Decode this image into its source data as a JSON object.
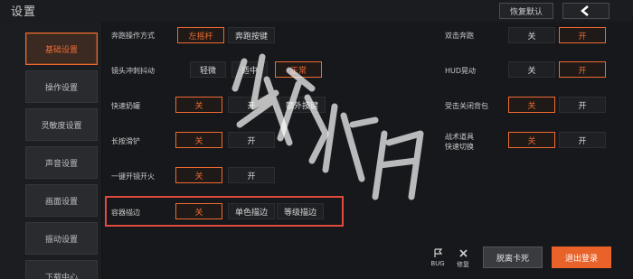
{
  "header": {
    "title": "设置",
    "reset_label": "恢复默认"
  },
  "sidebar": {
    "items": [
      {
        "label": "基础设置",
        "active": true
      },
      {
        "label": "操作设置",
        "active": false
      },
      {
        "label": "灵敏度设置",
        "active": false
      },
      {
        "label": "声音设置",
        "active": false
      },
      {
        "label": "画面设置",
        "active": false
      },
      {
        "label": "振动设置",
        "active": false
      },
      {
        "label": "下载中心",
        "active": false
      }
    ]
  },
  "settings_left": [
    {
      "label": "奔跑操作方式",
      "options": [
        "左摇杆",
        "奔跑按键"
      ],
      "selected": 0
    },
    {
      "label": "镜头冲刺抖动",
      "options": [
        "轻微",
        "适中",
        "正常"
      ],
      "selected": 2
    },
    {
      "label": "快速奶罐",
      "options": [
        "关",
        "开",
        "额外按键"
      ],
      "selected": 0
    },
    {
      "label": "长按滑铲",
      "options": [
        "关",
        "开"
      ],
      "selected": 0
    },
    {
      "label": "一键开镜开火",
      "options": [
        "关",
        "开"
      ],
      "selected": 0
    },
    {
      "label": "容器描边",
      "options": [
        "关",
        "单色描边",
        "等级描边"
      ],
      "selected": 0
    }
  ],
  "settings_right": [
    {
      "label": "双击奔跑",
      "options": [
        "关",
        "开"
      ],
      "selected": 1
    },
    {
      "label": "HUD晃动",
      "options": [
        "关",
        "开"
      ],
      "selected": 1
    },
    {
      "label": "受击关闭背包",
      "options": [
        "关",
        "开"
      ],
      "selected": 0
    },
    {
      "label": "战术道具\n快速切换",
      "options": [
        "关",
        "开"
      ],
      "selected": 0
    }
  ],
  "tools": {
    "bug_label": "BUG",
    "fix_label": "修复"
  },
  "footer": {
    "escape_label": "脱离卡死",
    "logout_label": "退出登录"
  },
  "colors": {
    "accent": "#f06a30",
    "highlight_box": "#e04a3c"
  },
  "icons": {
    "back": "chevron-left-icon",
    "bug": "flag-icon",
    "fix": "wrench-icon"
  },
  "watermark_text": "游侠网"
}
